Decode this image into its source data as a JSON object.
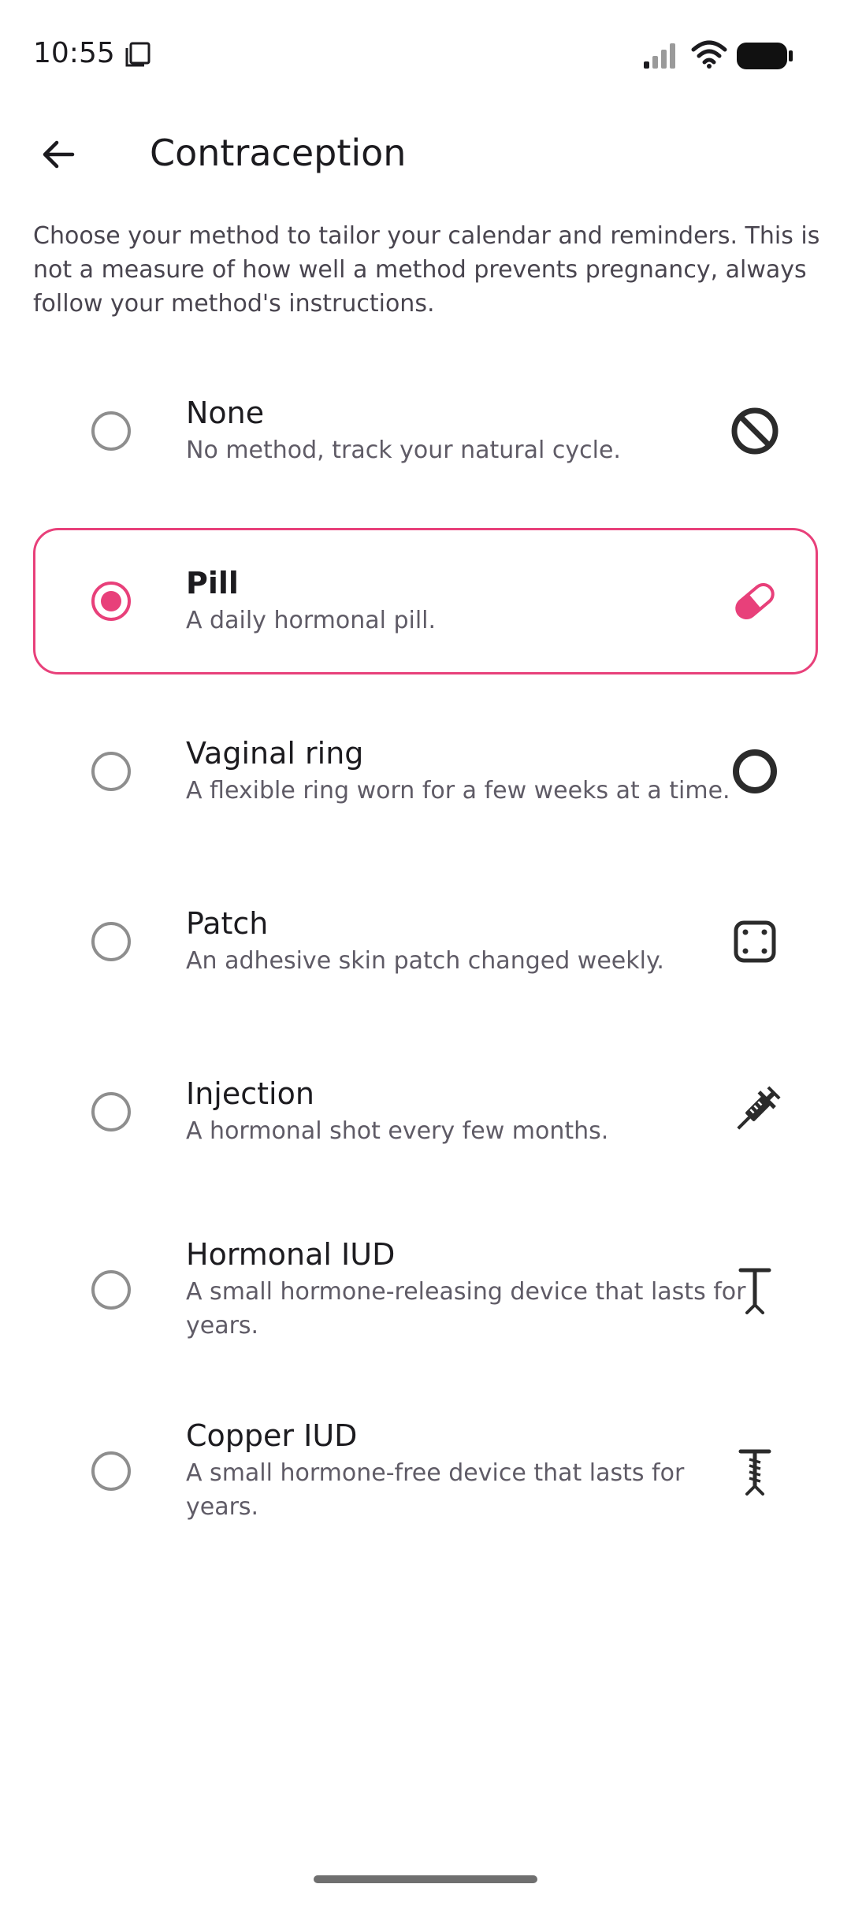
{
  "status_bar": {
    "time": "10:55"
  },
  "header": {
    "title": "Contraception"
  },
  "intro": "Choose your method to tailor your calendar and reminders. This is not a measure of how well a method prevents pregnancy, always follow your method's instructions.",
  "options": [
    {
      "title": "None",
      "description": "No method, track your natural cycle.",
      "icon": "no-method-icon",
      "selected": false
    },
    {
      "title": "Pill",
      "description": "A daily hormonal pill.",
      "icon": "pill-icon",
      "selected": true
    },
    {
      "title": "Vaginal ring",
      "description": "A flexible ring worn for a few weeks at a time.",
      "icon": "ring-icon",
      "selected": false
    },
    {
      "title": "Patch",
      "description": "An adhesive skin patch changed weekly.",
      "icon": "patch-icon",
      "selected": false
    },
    {
      "title": "Injection",
      "description": "A hormonal shot every few months.",
      "icon": "syringe-icon",
      "selected": false
    },
    {
      "title": "Hormonal IUD",
      "description": "A small hormone-releasing device that lasts for years.",
      "icon": "hormonal-iud-icon",
      "selected": false
    },
    {
      "title": "Copper IUD",
      "description": "A small hormone-free device that lasts for years.",
      "icon": "copper-iud-icon",
      "selected": false
    }
  ],
  "colors": {
    "accent": "#e8407a",
    "radio_unselected": "#8e8e8e",
    "icon": "#2b2b2b"
  }
}
